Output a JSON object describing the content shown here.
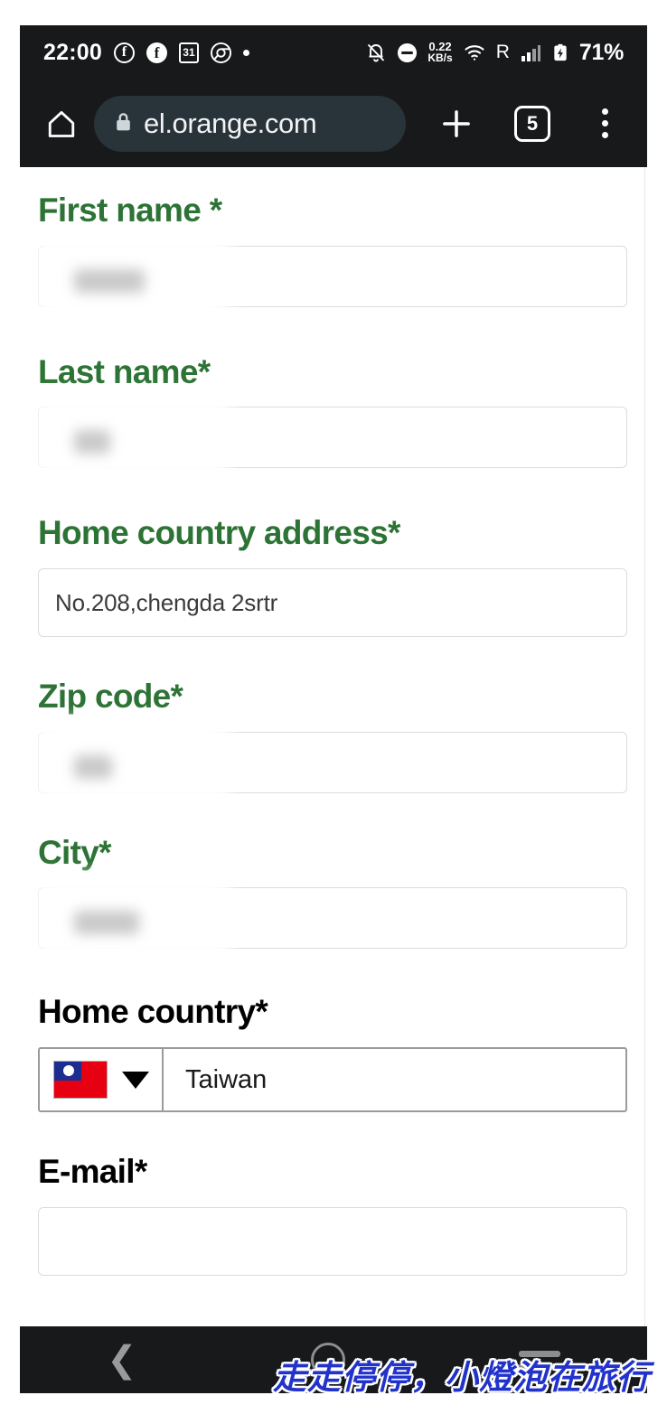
{
  "status_bar": {
    "clock": "22:00",
    "network_speed": "0.22",
    "network_speed_unit": "KB/s",
    "roaming": "R",
    "battery": "71%",
    "icons": [
      "facebook-outline-icon",
      "facebook-icon",
      "calendar-icon",
      "chrome-icon",
      "dot-icon",
      "bell-muted-icon",
      "do-not-disturb-icon",
      "wifi-icon",
      "signal-bars-icon",
      "battery-charging-icon"
    ],
    "calendar_day": "31"
  },
  "browser": {
    "home_icon": "home-icon",
    "lock_icon": "lock-icon",
    "url": "el.orange.com",
    "new_tab_label": "+",
    "tab_count": "5",
    "menu_icon": "overflow-menu-icon"
  },
  "form": {
    "fields": [
      {
        "label": "First name *",
        "label_color": "green",
        "value": "",
        "redacted": true,
        "redact_width": 78
      },
      {
        "label": "Last name*",
        "label_color": "green",
        "value": "",
        "redacted": true,
        "redact_width": 40
      },
      {
        "label": "Home country address*",
        "label_color": "green",
        "value": "No.208,chengda 2srtr",
        "redacted": false
      },
      {
        "label": "Zip code*",
        "label_color": "green",
        "value": "",
        "redacted": true,
        "redact_width": 42
      },
      {
        "label": "City*",
        "label_color": "green",
        "value": "",
        "redacted": true,
        "redact_width": 72
      }
    ],
    "country": {
      "label": "Home country*",
      "label_color": "black",
      "flag": "taiwan-flag-icon",
      "selected": "Taiwan",
      "caret_icon": "chevron-down-icon"
    },
    "email": {
      "label": "E-mail*",
      "label_color": "black",
      "value": ""
    }
  },
  "nav_bar": {
    "back_icon": "back-chevron-icon",
    "home_icon": "home-circle-icon",
    "recents_icon": "recents-icon"
  },
  "watermark": {
    "text": "走走停停，小燈泡在旅行"
  },
  "colors": {
    "label_green": "#2c7335",
    "chrome_dark": "#17191b",
    "url_pill": "#29333a",
    "watermark_blue": "#2233cc"
  }
}
